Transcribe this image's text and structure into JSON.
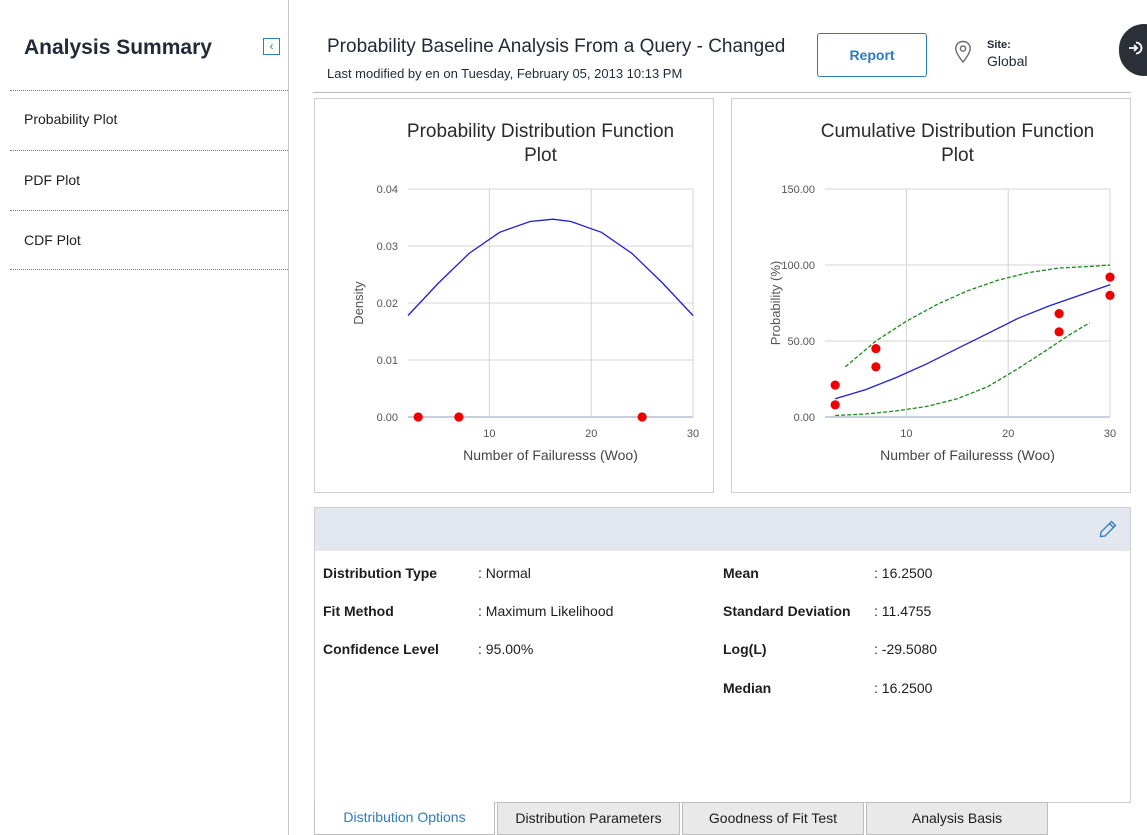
{
  "sidebar": {
    "title": "Analysis Summary",
    "collapse_icon": "chevron-left-icon",
    "items": [
      {
        "label": "Probability Plot"
      },
      {
        "label": "PDF Plot"
      },
      {
        "label": "CDF Plot"
      }
    ]
  },
  "header": {
    "title": "Probability Baseline Analysis From a Query - Changed",
    "subtitle": "Last modified by en on Tuesday, February 05, 2013 10:13 PM",
    "report_label": "Report",
    "site_label": "Site:",
    "site_value": "Global"
  },
  "colors": {
    "accent": "#2e7bbf",
    "fit_line": "#1f1fd6",
    "bound_line": "#1a8a1a",
    "points": "#ee0000",
    "header_bg": "#e3e8f0"
  },
  "chart_data": [
    {
      "type": "line",
      "title": "Probability Distribution Function Plot",
      "title_lines": [
        "Probability Distribution Function",
        "Plot"
      ],
      "xlabel": "Number of Failuresss (Woo)",
      "ylabel": "Density",
      "xlim": [
        2,
        30
      ],
      "ylim": [
        0,
        0.04
      ],
      "xticks": [
        10,
        20,
        30
      ],
      "xtick_labels": [
        "10",
        "20",
        "30"
      ],
      "yticks": [
        0,
        0.01,
        0.02,
        0.03,
        0.04
      ],
      "ytick_labels": [
        "0.00",
        "0.01",
        "0.02",
        "0.03",
        "0.04"
      ],
      "grid": true,
      "series": [
        {
          "kind": "line",
          "x": [
            2.0,
            5.0,
            8.0,
            11.0,
            14.0,
            16.25,
            18.0,
            21.0,
            24.0,
            27.0,
            30.0
          ],
          "y": [
            0.0178,
            0.0235,
            0.0287,
            0.0324,
            0.0343,
            0.0347,
            0.0343,
            0.0324,
            0.0287,
            0.0235,
            0.0178
          ]
        },
        {
          "kind": "points",
          "x": [
            3,
            7,
            25
          ],
          "y": [
            0,
            0,
            0
          ]
        }
      ]
    },
    {
      "type": "line",
      "title": "Cumulative Distribution Function Plot",
      "title_lines": [
        "Cumulative Distribution Function",
        "Plot"
      ],
      "xlabel": "Number of Failuresss (Woo)",
      "ylabel": "Probability (%)",
      "xlim": [
        2,
        30
      ],
      "ylim": [
        0,
        150
      ],
      "xticks": [
        10,
        20,
        30
      ],
      "xtick_labels": [
        "10",
        "20",
        "30"
      ],
      "yticks": [
        0,
        50,
        100,
        150
      ],
      "ytick_labels": [
        "0.00",
        "50.00",
        "100.00",
        "150.00"
      ],
      "grid": true,
      "series": [
        {
          "kind": "line",
          "x": [
            3,
            6,
            9,
            12,
            15,
            18,
            21,
            24,
            27,
            30
          ],
          "y": [
            12,
            18,
            26,
            35,
            45,
            55,
            65,
            73,
            80,
            87
          ]
        },
        {
          "kind": "dashed",
          "x": [
            4,
            7,
            10,
            13,
            16,
            19,
            22,
            25,
            28,
            30
          ],
          "y": [
            33,
            50,
            63,
            74,
            83,
            90,
            95,
            98,
            99,
            100
          ]
        },
        {
          "kind": "dashed",
          "x": [
            3,
            6,
            9,
            12,
            15,
            18,
            21,
            24,
            26,
            28
          ],
          "y": [
            1,
            2,
            4,
            7,
            12,
            20,
            32,
            45,
            54,
            62
          ]
        },
        {
          "kind": "points",
          "x": [
            3,
            3,
            7,
            7,
            25,
            25,
            30,
            30
          ],
          "y": [
            8,
            21,
            33,
            45,
            56,
            68,
            80,
            92
          ]
        }
      ]
    }
  ],
  "details": {
    "edit_icon": "pencil-icon",
    "left": [
      {
        "label": "Distribution Type",
        "value": ": Normal"
      },
      {
        "label": "Fit Method",
        "value": ": Maximum Likelihood"
      },
      {
        "label": "Confidence Level",
        "value": ": 95.00%"
      }
    ],
    "right": [
      {
        "label": "Mean",
        "value": ": 16.2500"
      },
      {
        "label": "Standard Deviation",
        "value": ": 11.4755"
      },
      {
        "label": "Log(L)",
        "value": ": -29.5080"
      },
      {
        "label": "Median",
        "value": ": 16.2500"
      }
    ]
  },
  "tabs": [
    {
      "label": "Distribution Options",
      "active": true
    },
    {
      "label": "Distribution Parameters",
      "active": false
    },
    {
      "label": "Goodness of Fit Test",
      "active": false
    },
    {
      "label": "Analysis Basis",
      "active": false
    }
  ]
}
